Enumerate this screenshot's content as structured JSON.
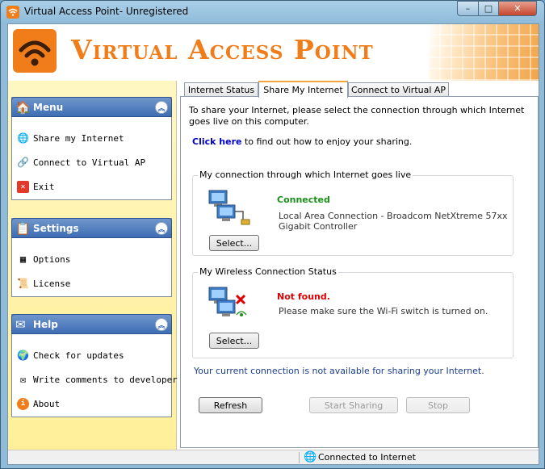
{
  "window": {
    "title": "Virtual Access Point- Unregistered",
    "minimize_glyph": "–",
    "maximize_glyph": "□",
    "close_glyph": "✕"
  },
  "banner": {
    "title": "Virtual Access Point",
    "accent_color": "#f07d1a"
  },
  "sidebar": {
    "groups": [
      {
        "title": "Menu",
        "icon": "home-icon",
        "items": [
          {
            "label": "Share my Internet",
            "icon": "share-globe-icon"
          },
          {
            "label": "Connect to Virtual AP",
            "icon": "connect-icon"
          },
          {
            "label": "Exit",
            "icon": "exit-icon"
          }
        ]
      },
      {
        "title": "Settings",
        "icon": "settings-icon",
        "items": [
          {
            "label": "Options",
            "icon": "options-grid-icon"
          },
          {
            "label": "License",
            "icon": "license-icon"
          }
        ]
      },
      {
        "title": "Help",
        "icon": "envelope-icon",
        "items": [
          {
            "label": "Check for updates",
            "icon": "globe-icon"
          },
          {
            "label": "Write comments to developer",
            "icon": "mail-icon"
          },
          {
            "label": "About",
            "icon": "about-icon"
          }
        ]
      }
    ],
    "collapse_glyph": "︽"
  },
  "tabs": [
    {
      "label": "Internet Status",
      "active": false
    },
    {
      "label": "Share My Internet",
      "active": true
    },
    {
      "label": "Connect to Virtual AP",
      "active": false
    }
  ],
  "main": {
    "intro": "To share your Internet, please select the connection through which Internet goes live on this computer.",
    "help_link": "Click here",
    "help_suffix": "to find out how to enjoy your sharing.",
    "connection_box": {
      "legend": "My connection  through which Internet goes live",
      "status": "Connected",
      "status_color": "#1a8f1a",
      "detail": "Local Area Connection - Broadcom NetXtreme 57xx Gigabit Controller",
      "select_label": "Select..."
    },
    "wireless_box": {
      "legend": "My Wireless Connection Status",
      "status": "Not found.",
      "status_color": "#e00000",
      "detail": "Please make sure the Wi-Fi switch is turned on.",
      "select_label": "Select..."
    },
    "sharing_message": "Your current connection is not available for sharing your Internet.",
    "refresh_label": "Refresh",
    "start_sharing_label": "Start Sharing",
    "stop_label": "Stop"
  },
  "statusbar": {
    "text": "Connected to Internet",
    "icon": "globe-icon"
  }
}
